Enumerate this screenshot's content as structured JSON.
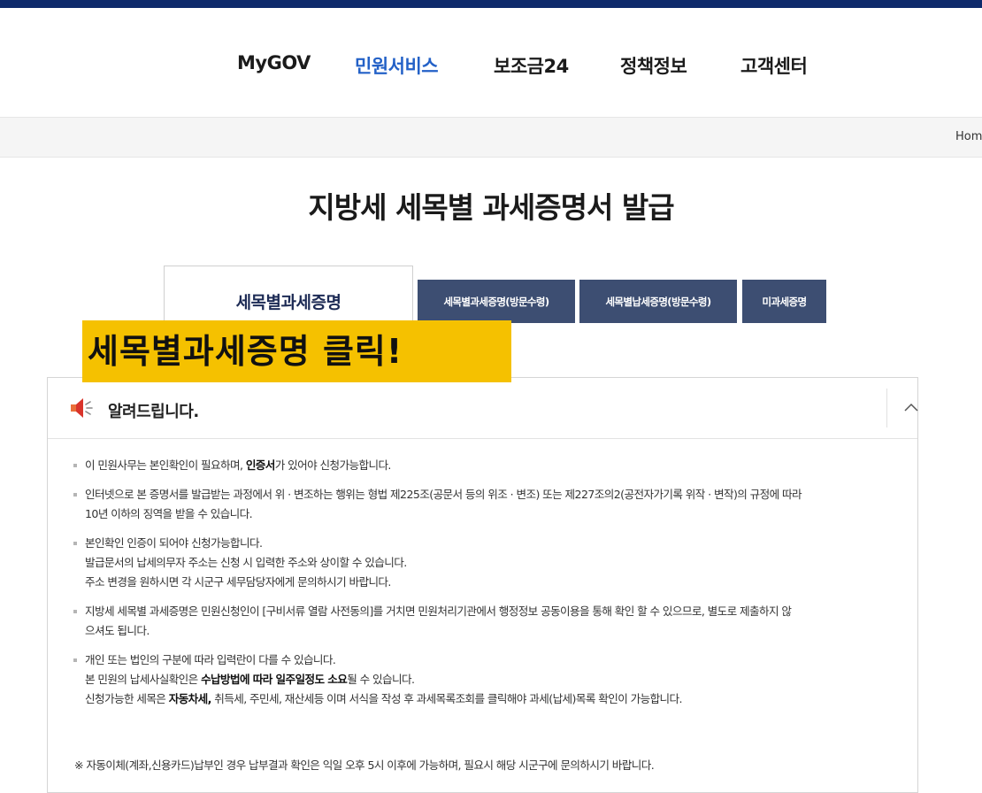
{
  "nav": {
    "items": [
      "MyGOV",
      "민원서비스",
      "보조금24",
      "정책정보",
      "고객센터"
    ],
    "active_index": 1
  },
  "breadcrumb": {
    "home": "Hom"
  },
  "page": {
    "title": "지방세 세목별 과세증명서 발급"
  },
  "tabs": {
    "active": "세목별과세증명",
    "others": [
      "세목별과세증명(방문수령)",
      "세목별납세증명(방문수령)",
      "미과세증명"
    ]
  },
  "callout": {
    "text": "세목별과세증명 클릭!"
  },
  "notice": {
    "title": "알려드립니다.",
    "items": [
      {
        "lines": [
          {
            "pre": "이 민원사무는 본인확인이 필요하며, ",
            "bold": "인증서",
            "post": "가 있어야 신청가능합니다."
          }
        ]
      },
      {
        "lines": [
          {
            "pre": "인터넷으로 본 증명서를 발급받는 과정에서 위 · 변조하는 행위는 형법 제225조(공문서 등의 위조 · 변조) 또는 제227조의2(공전자가기록 위작 · 변작)의 규정에 따라",
            "bold": "",
            "post": ""
          },
          {
            "pre": "10년 이하의 징역을 받을 수 있습니다.",
            "bold": "",
            "post": ""
          }
        ]
      },
      {
        "lines": [
          {
            "pre": "본인확인 인증이 되어야 신청가능합니다.",
            "bold": "",
            "post": ""
          },
          {
            "pre": "발급문서의 납세의무자 주소는 신청 시 입력한 주소와 상이할 수 있습니다.",
            "bold": "",
            "post": ""
          },
          {
            "pre": "주소 변경을 원하시면 각 시군구 세무담당자에게 문의하시기 바랍니다.",
            "bold": "",
            "post": ""
          }
        ]
      },
      {
        "lines": [
          {
            "pre": "지방세 세목별 과세증명은 민원신청인이 [구비서류 열람 사전동의]를 거치면 민원처리기관에서 행정정보 공동이용을 통해 확인 할 수 있으므로, 별도로 제출하지 않",
            "bold": "",
            "post": ""
          },
          {
            "pre": "으셔도 됩니다.",
            "bold": "",
            "post": ""
          }
        ]
      },
      {
        "lines": [
          {
            "pre": "개인 또는 법인의 구분에 따라 입력란이 다를 수 있습니다.",
            "bold": "",
            "post": ""
          },
          {
            "pre": "본 민원의 납세사실확인은 ",
            "bold": "수납방법에 따라 일주일정도 소요",
            "post": "될 수 있습니다."
          },
          {
            "pre": "신청가능한 세목은 ",
            "bold": "자동차세,",
            "post": " 취득세, 주민세, 재산세등 이며 서식을 작성 후 과세목록조회를 클릭해야 과세(납세)목록 확인이 가능합니다."
          }
        ]
      }
    ],
    "footnote": "※ 자동이체(계좌,신용카드)납부인 경우 납부결과 확인은 익일 오후 5시 이후에 가능하며, 필요시 해당 시군구에 문의하시기 바랍니다."
  },
  "colors": {
    "nav_active": "#2361c7",
    "tab_bg": "#3d4e72",
    "callout_bg": "#f5c100",
    "topbar": "#0e2a6b"
  },
  "icons": {
    "notice": "megaphone-icon",
    "toggle": "chevron-up-icon"
  }
}
